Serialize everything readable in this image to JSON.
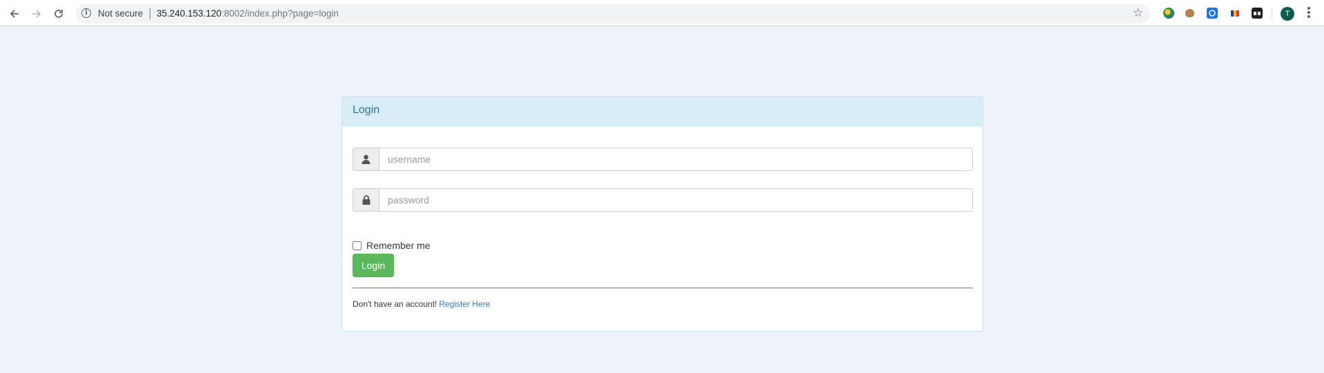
{
  "browser": {
    "security_label": "Not secure",
    "url_host": "35.240.153.120",
    "url_rest": ":8002/index.php?page=login",
    "avatar_letter": "T",
    "icons": [
      "back-icon",
      "forward-icon",
      "reload-icon",
      "info-icon",
      "star-icon",
      "menu-icon"
    ]
  },
  "panel": {
    "title": "Login",
    "username_placeholder": "username",
    "password_placeholder": "password",
    "remember_label": "Remember me",
    "remember_checked": false,
    "login_button": "Login",
    "footer_text": "Don't have an account!",
    "register_link": "Register Here"
  },
  "colors": {
    "page_bg": "#eef2f9",
    "panel_heading_bg": "#d9edf7",
    "panel_heading_text": "#31708f",
    "button_bg": "#5cb85c",
    "link": "#337ab7"
  }
}
